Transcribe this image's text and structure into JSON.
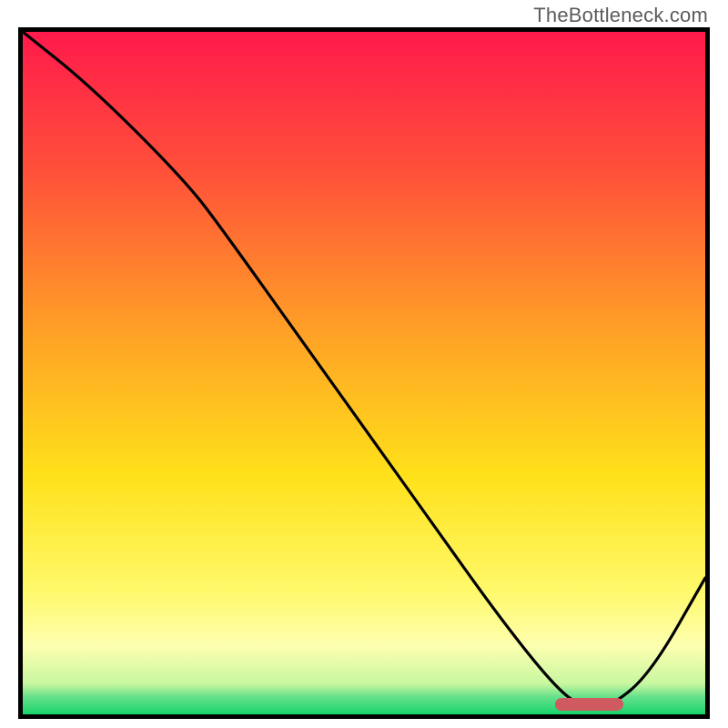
{
  "watermark": "TheBottleneck.com",
  "chart_data": {
    "type": "line",
    "title": "",
    "xlabel": "",
    "ylabel": "",
    "xlim": [
      0,
      100
    ],
    "ylim": [
      0,
      100
    ],
    "gradient_stops": [
      {
        "offset": 0.0,
        "color": "#ff1a4b"
      },
      {
        "offset": 0.2,
        "color": "#ff4f3a"
      },
      {
        "offset": 0.45,
        "color": "#ffa425"
      },
      {
        "offset": 0.65,
        "color": "#ffe11a"
      },
      {
        "offset": 0.82,
        "color": "#fff96b"
      },
      {
        "offset": 0.9,
        "color": "#fdffb0"
      },
      {
        "offset": 0.955,
        "color": "#c8f7a0"
      },
      {
        "offset": 0.975,
        "color": "#63e08a"
      },
      {
        "offset": 1.0,
        "color": "#17d36b"
      }
    ],
    "series": [
      {
        "name": "bottleneck-curve",
        "x": [
          0,
          10,
          24,
          30,
          40,
          50,
          60,
          70,
          78,
          82,
          86,
          92,
          100
        ],
        "y": [
          100,
          92,
          78,
          70,
          56,
          42,
          28,
          14,
          4,
          1,
          1,
          6,
          20
        ]
      }
    ],
    "optimal_range": {
      "x_start": 78,
      "x_end": 88,
      "y": 1.5
    },
    "marker_color": "#cf5b60"
  }
}
